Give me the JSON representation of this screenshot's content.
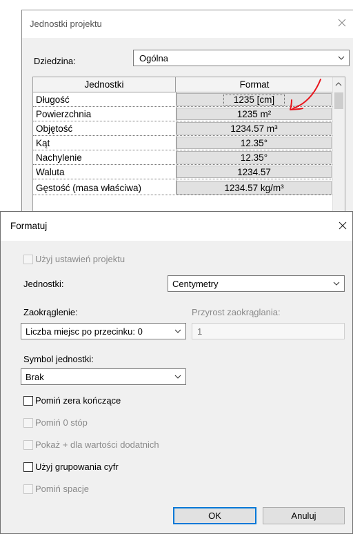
{
  "back_dialog": {
    "title": "Jednostki projektu",
    "dziedzina_label": "Dziedzina:",
    "dziedzina_value": "Ogólna",
    "columns": [
      "Jednostki",
      "Format"
    ],
    "rows": [
      {
        "name": "Długość",
        "format": "1235 [cm]"
      },
      {
        "name": "Powierzchnia",
        "format": "1235 m²"
      },
      {
        "name": "Objętość",
        "format": "1234.57 m³"
      },
      {
        "name": "Kąt",
        "format": "12.35°"
      },
      {
        "name": "Nachylenie",
        "format": "12.35°"
      },
      {
        "name": "Waluta",
        "format": "1234.57"
      },
      {
        "name": "Gęstość (masa właściwa)",
        "format": "1234.57 kg/m³"
      }
    ],
    "annotation_color": "#e8161d"
  },
  "format_dialog": {
    "title": "Formatuj",
    "use_project_settings": "Użyj ustawień projektu",
    "units_label": "Jednostki:",
    "units_value": "Centymetry",
    "rounding_label": "Zaokrąglenie:",
    "rounding_value": "Liczba miejsc po przecinku: 0",
    "rounding_increment_label": "Przyrost zaokrąglania:",
    "rounding_increment_value": "1",
    "unit_symbol_label": "Symbol jednostki:",
    "unit_symbol_value": "Brak",
    "options": [
      {
        "label": "Pomiń zera kończące",
        "enabled": true,
        "checked": false
      },
      {
        "label": "Pomiń 0 stóp",
        "enabled": false,
        "checked": false
      },
      {
        "label": "Pokaż + dla wartości dodatnich",
        "enabled": false,
        "checked": false
      },
      {
        "label": "Użyj grupowania cyfr",
        "enabled": true,
        "checked": false
      },
      {
        "label": "Pomiń spacje",
        "enabled": false,
        "checked": false
      }
    ],
    "ok_label": "OK",
    "cancel_label": "Anuluj",
    "accent_color": "#0078d7"
  }
}
